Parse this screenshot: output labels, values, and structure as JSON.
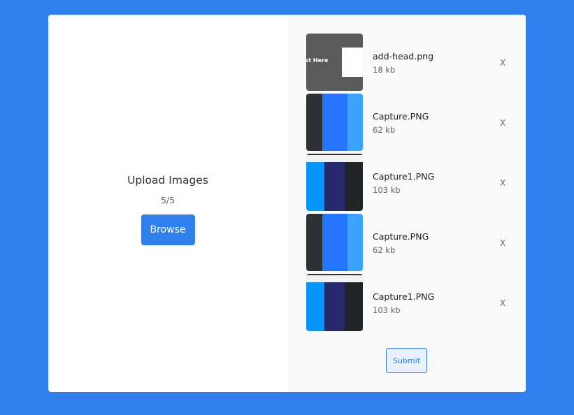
{
  "upload": {
    "title": "Upload Images",
    "count": "5/5",
    "browse_label": "Browse"
  },
  "files": [
    {
      "name": "add-head.png",
      "size": "18 kb",
      "remove": "X",
      "thumb": "gray-text",
      "thumb_text": "xt Here"
    },
    {
      "name": "Capture.PNG",
      "size": "62 kb",
      "remove": "X",
      "thumb": "palette-a",
      "colors": [
        "#2c3236",
        "#2574ff",
        "#3aa3ff"
      ]
    },
    {
      "name": "Capture1.PNG",
      "size": "103 kb",
      "remove": "X",
      "thumb": "palette-b",
      "colors": [
        "#0596ff",
        "#272a6c",
        "#232428"
      ]
    },
    {
      "name": "Capture.PNG",
      "size": "62 kb",
      "remove": "X",
      "thumb": "palette-a",
      "colors": [
        "#2c3236",
        "#2574ff",
        "#3aa3ff"
      ]
    },
    {
      "name": "Capture1.PNG",
      "size": "103 kb",
      "remove": "X",
      "thumb": "palette-b",
      "colors": [
        "#0596ff",
        "#272a6c",
        "#232428"
      ]
    }
  ],
  "submit_label": "Submit"
}
